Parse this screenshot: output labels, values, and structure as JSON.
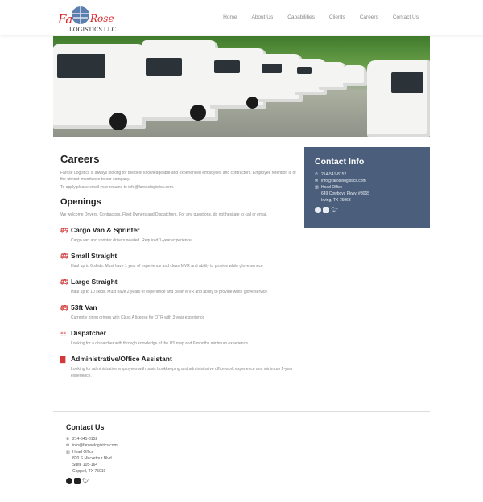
{
  "header": {
    "logo_text": "FaRose Logistics LLC",
    "nav": [
      "Home",
      "About Us",
      "Capabilities",
      "Clients",
      "Careers",
      "Contact Us"
    ]
  },
  "careers": {
    "title": "Careers",
    "intro": "Farose Logistics is always looking for the best knowledgeable and experienced employees and contractors. Employee retention is of the utmost importance to our company.",
    "apply": "To apply please email your resume to info@faroselogistics.com."
  },
  "openings": {
    "title": "Openings",
    "intro": "We welcome Drivers, Contractors, Fleet Owners and Dispatchers.  For any questions, do not hesitate to call or email.",
    "jobs": [
      {
        "title": "Cargo Van & Sprinter",
        "desc": "Cargo van and sprinter drivers needed. Required 1-year experience.",
        "icon": "bus-icon"
      },
      {
        "title": "Small Straight",
        "desc": "Haul up to 6 skids. Must have 1 year of experience and clean MVR and ability to provide white glove service",
        "icon": "bus-icon"
      },
      {
        "title": "Large Straight",
        "desc": "Haul up to 10 skids. Must have 2 years of experience and clean MVR and ability to provide white glove service",
        "icon": "bus-icon"
      },
      {
        "title": "53ft Van",
        "desc": "Currently hiring drivers with Class A license for OTR with 3 year experience",
        "icon": "bus-icon"
      },
      {
        "title": "Dispatcher",
        "desc": "Looking for a dispatcher with through knowledge of the US map and 6 months minimum experience",
        "icon": "signpost-icon"
      },
      {
        "title": "Administrative/Office Assistant",
        "desc": "Looking for administrative employees with basic bookkeeping and administrative office work experience and minimum 1-year experience.",
        "icon": "book-icon"
      }
    ]
  },
  "contact_info": {
    "title": "Contact Info",
    "phone": "214-541-8152",
    "email": "info@faroselogistics.com",
    "office": "Head Office",
    "addr1": "649 Cowboys Pkwy, #3065",
    "addr2": "Irving, TX 75063"
  },
  "footer": {
    "title": "Contact Us",
    "phone": "214-541-8152",
    "email": "info@faroselogistics.com",
    "office": "Head Office",
    "addr1": "820 S MacArthur Blvd",
    "addr2": "Suite 105-164",
    "addr3": "Coppell, TX 75019"
  },
  "colors": {
    "accent": "#d23a3a",
    "panel": "#4b5f7c"
  }
}
